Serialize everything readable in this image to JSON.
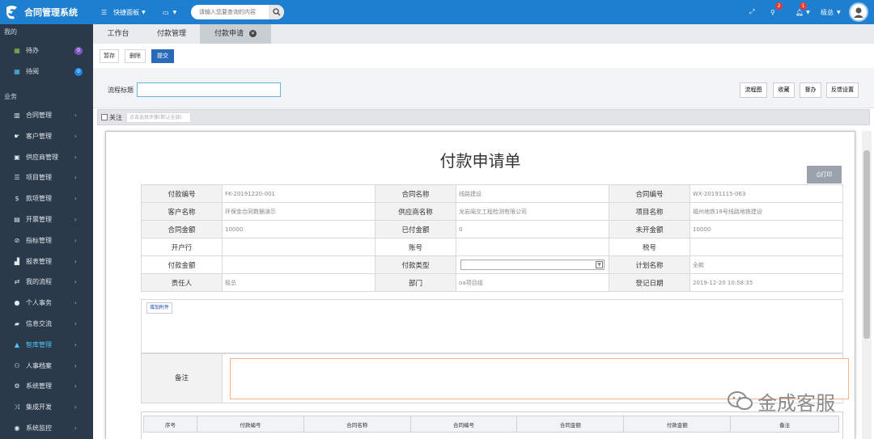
{
  "app": {
    "title": "合同管理系统"
  },
  "topbar": {
    "shortcut_label": "快捷面板",
    "search_placeholder": "请输入您要查询的内容",
    "notification_badge": "2",
    "message_badge": "1",
    "user_name": "极总"
  },
  "sidebar": {
    "section_mine": "我的",
    "todo": {
      "label": "待办",
      "count": "0"
    },
    "read": {
      "label": "待阅",
      "count": "0"
    },
    "section_business": "业务",
    "items": [
      {
        "label": "合同管理",
        "icon": "book-icon"
      },
      {
        "label": "客户管理",
        "icon": "handshake-icon"
      },
      {
        "label": "供应商管理",
        "icon": "briefcase-icon"
      },
      {
        "label": "项目管理",
        "icon": "list-icon"
      },
      {
        "label": "款项管理",
        "icon": "dollar-icon"
      },
      {
        "label": "开票管理",
        "icon": "invoice-icon"
      },
      {
        "label": "指标管理",
        "icon": "link-icon"
      },
      {
        "label": "报表管理",
        "icon": "bar-chart-icon"
      },
      {
        "label": "我的流程",
        "icon": "exchange-icon"
      },
      {
        "label": "个人事务",
        "icon": "user-icon"
      },
      {
        "label": "信息交流",
        "icon": "chat-icon"
      },
      {
        "label": "智库管理",
        "icon": "graduation-icon"
      },
      {
        "label": "人事档案",
        "icon": "group-icon"
      },
      {
        "label": "系统管理",
        "icon": "gear-icon"
      },
      {
        "label": "集成开发",
        "icon": "shuffle-icon"
      },
      {
        "label": "系统监控",
        "icon": "eye-icon"
      }
    ]
  },
  "tabs": [
    {
      "label": "工作台"
    },
    {
      "label": "付款管理"
    },
    {
      "label": "付款申请"
    }
  ],
  "toolbar": {
    "save_draft": "暂存",
    "delete": "删除",
    "submit": "提交"
  },
  "form_header": {
    "title_label": "流程标题",
    "buttons": [
      "流程图",
      "收藏",
      "督办",
      "反馈设置"
    ],
    "follow_label": "关注",
    "step_placeholder": "点击选择步骤(默认全部)"
  },
  "document": {
    "title": "付款申请单",
    "print_label": "打印",
    "rows": [
      [
        {
          "label": "付款编号",
          "value": "FK-20191220-001"
        },
        {
          "label": "合同名称",
          "value": "线路建设"
        },
        {
          "label": "合同编号",
          "value": "WX-20191115-063"
        }
      ],
      [
        {
          "label": "客户名称",
          "value": "环保金合同数据演示"
        },
        {
          "label": "供应商名称",
          "value": "龙岩闽交工程检测有限公司"
        },
        {
          "label": "项目名称",
          "value": "福州地铁18号线路地铁建设"
        }
      ],
      [
        {
          "label": "合同金额",
          "value": "10000"
        },
        {
          "label": "已付金额",
          "value": "0"
        },
        {
          "label": "未开金额",
          "value": "10000"
        }
      ],
      [
        {
          "label": "开户行",
          "value": ""
        },
        {
          "label": "账号",
          "value": ""
        },
        {
          "label": "税号",
          "value": ""
        }
      ],
      [
        {
          "label": "付款金额",
          "value": ""
        },
        {
          "label": "付款类型",
          "value": ""
        },
        {
          "label": "计划名称",
          "value": "全款"
        }
      ],
      [
        {
          "label": "责任人",
          "value": "极总"
        },
        {
          "label": "部门",
          "value": "oa项目组"
        },
        {
          "label": "登记日期",
          "value": "2019-12-20 10:58:35"
        }
      ]
    ],
    "add_attachment": "增加附件",
    "remark_label": "备注",
    "detail_columns": [
      "序号",
      "付款编号",
      "合同名称",
      "合同编号",
      "合同金额",
      "付款金额",
      "备注"
    ]
  },
  "watermark": {
    "text": "金成客服"
  }
}
